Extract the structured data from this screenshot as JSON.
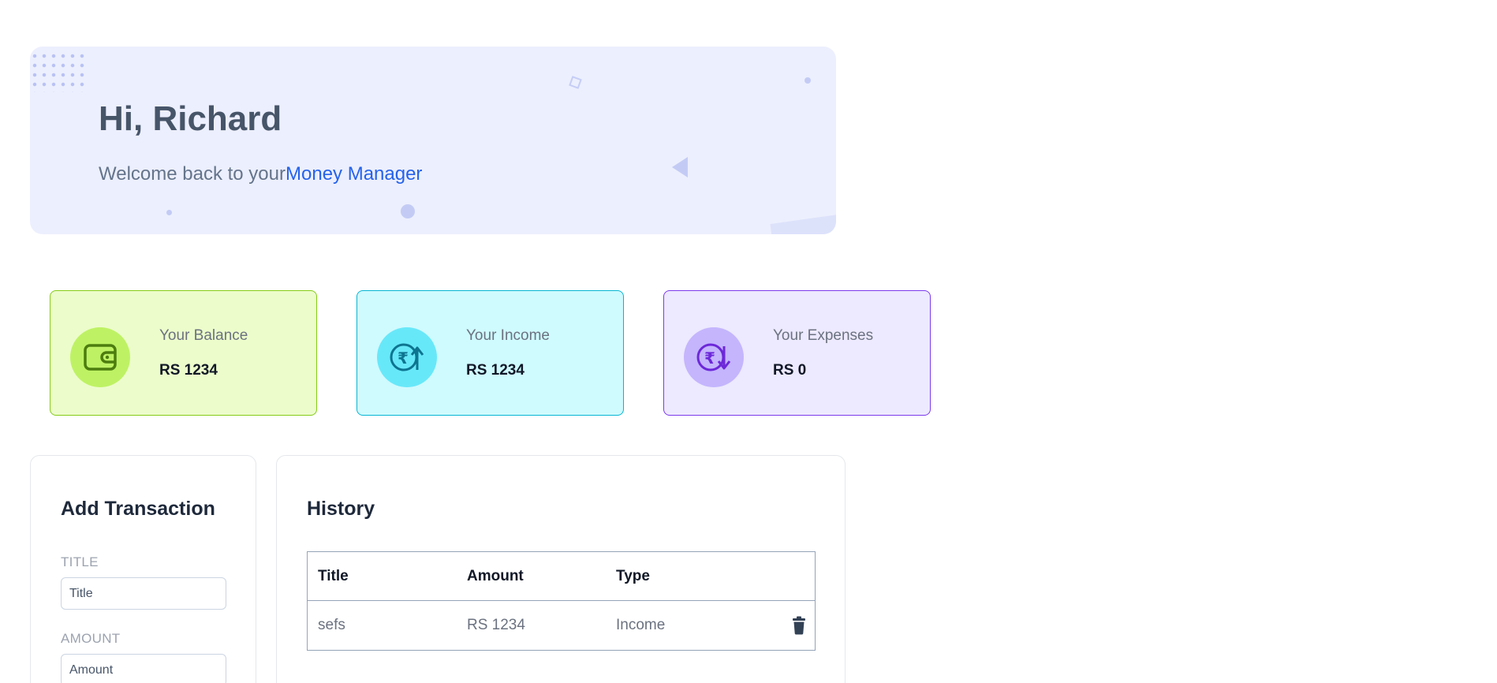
{
  "banner": {
    "greeting": "Hi, Richard",
    "welcome_prefix": "Welcome back to your",
    "welcome_accent": "Money Manager"
  },
  "stats": {
    "balance": {
      "label": "Your Balance",
      "value": "RS 1234",
      "icon": "wallet-icon",
      "color": "#84cc16"
    },
    "income": {
      "label": "Your Income",
      "value": "RS 1234",
      "icon": "rupee-up-icon",
      "color": "#06b6d4"
    },
    "expenses": {
      "label": "Your Expenses",
      "value": "RS 0",
      "icon": "rupee-down-icon",
      "color": "#7c3aed"
    }
  },
  "add_transaction": {
    "heading": "Add Transaction",
    "title_label": "TITLE",
    "title_placeholder": "Title",
    "amount_label": "AMOUNT",
    "amount_placeholder": "Amount"
  },
  "history": {
    "heading": "History",
    "columns": [
      "Title",
      "Amount",
      "Type"
    ],
    "rows": [
      {
        "title": "sefs",
        "amount": "RS 1234",
        "type": "Income",
        "action_icon": "trash-icon"
      }
    ]
  },
  "colors": {
    "accent": "#2563eb",
    "banner_bg": "#eceffd"
  }
}
